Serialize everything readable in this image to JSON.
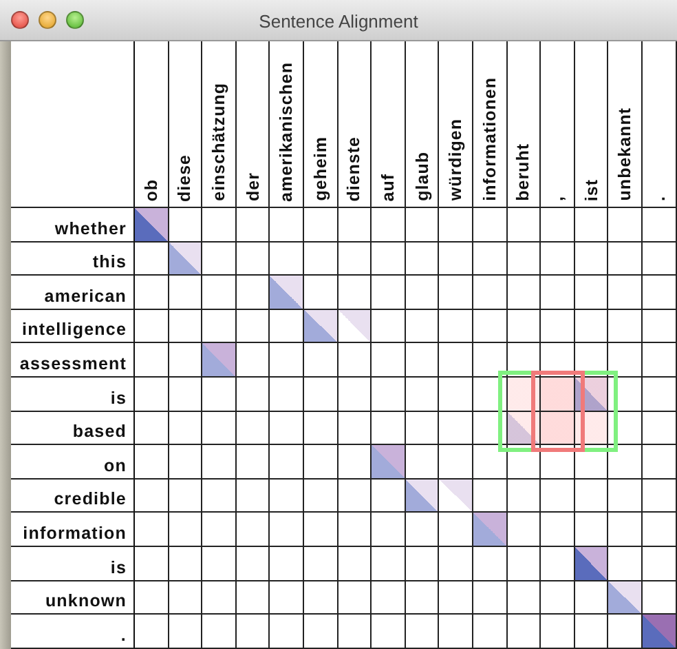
{
  "window": {
    "title": "Sentence Alignment"
  },
  "columns": [
    "ob",
    "diese",
    "einschätzung",
    "der",
    "amerikanischen",
    "geheim",
    "dienste",
    "auf",
    "glaub",
    "würdigen",
    "informationen",
    "beruht",
    ",",
    "ist",
    "unbekannt",
    "."
  ],
  "rows": [
    {
      "word": "whether",
      "cells": [
        {
          "kind": "medium-strong",
          "selected": false,
          "focused": false
        },
        {
          "kind": "empty",
          "selected": false,
          "focused": false
        },
        {
          "kind": "empty",
          "selected": false,
          "focused": false
        },
        {
          "kind": "empty",
          "selected": false,
          "focused": false
        },
        {
          "kind": "empty",
          "selected": false,
          "focused": false
        },
        {
          "kind": "empty",
          "selected": false,
          "focused": false
        },
        {
          "kind": "empty",
          "selected": false,
          "focused": false
        },
        {
          "kind": "empty",
          "selected": false,
          "focused": false
        },
        {
          "kind": "empty",
          "selected": false,
          "focused": false
        },
        {
          "kind": "empty",
          "selected": false,
          "focused": false
        },
        {
          "kind": "empty",
          "selected": false,
          "focused": false
        },
        {
          "kind": "empty",
          "selected": false,
          "focused": false
        },
        {
          "kind": "empty",
          "selected": false,
          "focused": false
        },
        {
          "kind": "empty",
          "selected": false,
          "focused": false
        },
        {
          "kind": "empty",
          "selected": false,
          "focused": false
        },
        {
          "kind": "empty",
          "selected": false,
          "focused": false
        }
      ]
    },
    {
      "word": "this",
      "cells": [
        {
          "kind": "empty",
          "selected": false,
          "focused": false
        },
        {
          "kind": "faint-medium",
          "selected": false,
          "focused": false
        },
        {
          "kind": "empty",
          "selected": false,
          "focused": false
        },
        {
          "kind": "empty",
          "selected": false,
          "focused": false
        },
        {
          "kind": "empty",
          "selected": false,
          "focused": false
        },
        {
          "kind": "empty",
          "selected": false,
          "focused": false
        },
        {
          "kind": "empty",
          "selected": false,
          "focused": false
        },
        {
          "kind": "empty",
          "selected": false,
          "focused": false
        },
        {
          "kind": "empty",
          "selected": false,
          "focused": false
        },
        {
          "kind": "empty",
          "selected": false,
          "focused": false
        },
        {
          "kind": "empty",
          "selected": false,
          "focused": false
        },
        {
          "kind": "empty",
          "selected": false,
          "focused": false
        },
        {
          "kind": "empty",
          "selected": false,
          "focused": false
        },
        {
          "kind": "empty",
          "selected": false,
          "focused": false
        },
        {
          "kind": "empty",
          "selected": false,
          "focused": false
        },
        {
          "kind": "empty",
          "selected": false,
          "focused": false
        }
      ]
    },
    {
      "word": "american",
      "cells": [
        {
          "kind": "empty",
          "selected": false,
          "focused": false
        },
        {
          "kind": "empty",
          "selected": false,
          "focused": false
        },
        {
          "kind": "empty",
          "selected": false,
          "focused": false
        },
        {
          "kind": "empty",
          "selected": false,
          "focused": false
        },
        {
          "kind": "faint-medium",
          "selected": false,
          "focused": false
        },
        {
          "kind": "empty",
          "selected": false,
          "focused": false
        },
        {
          "kind": "empty",
          "selected": false,
          "focused": false
        },
        {
          "kind": "empty",
          "selected": false,
          "focused": false
        },
        {
          "kind": "empty",
          "selected": false,
          "focused": false
        },
        {
          "kind": "empty",
          "selected": false,
          "focused": false
        },
        {
          "kind": "empty",
          "selected": false,
          "focused": false
        },
        {
          "kind": "empty",
          "selected": false,
          "focused": false
        },
        {
          "kind": "empty",
          "selected": false,
          "focused": false
        },
        {
          "kind": "empty",
          "selected": false,
          "focused": false
        },
        {
          "kind": "empty",
          "selected": false,
          "focused": false
        },
        {
          "kind": "empty",
          "selected": false,
          "focused": false
        }
      ]
    },
    {
      "word": "intelligence",
      "cells": [
        {
          "kind": "empty",
          "selected": false,
          "focused": false
        },
        {
          "kind": "empty",
          "selected": false,
          "focused": false
        },
        {
          "kind": "empty",
          "selected": false,
          "focused": false
        },
        {
          "kind": "empty",
          "selected": false,
          "focused": false
        },
        {
          "kind": "empty",
          "selected": false,
          "focused": false
        },
        {
          "kind": "faint-medium",
          "selected": false,
          "focused": false
        },
        {
          "kind": "faint-none",
          "selected": false,
          "focused": false
        },
        {
          "kind": "empty",
          "selected": false,
          "focused": false
        },
        {
          "kind": "empty",
          "selected": false,
          "focused": false
        },
        {
          "kind": "empty",
          "selected": false,
          "focused": false
        },
        {
          "kind": "empty",
          "selected": false,
          "focused": false
        },
        {
          "kind": "empty",
          "selected": false,
          "focused": false
        },
        {
          "kind": "empty",
          "selected": false,
          "focused": false
        },
        {
          "kind": "empty",
          "selected": false,
          "focused": false
        },
        {
          "kind": "empty",
          "selected": false,
          "focused": false
        },
        {
          "kind": "empty",
          "selected": false,
          "focused": false
        }
      ]
    },
    {
      "word": "assessment",
      "cells": [
        {
          "kind": "empty",
          "selected": false,
          "focused": false
        },
        {
          "kind": "empty",
          "selected": false,
          "focused": false
        },
        {
          "kind": "medium-medium",
          "selected": false,
          "focused": false
        },
        {
          "kind": "empty",
          "selected": false,
          "focused": false
        },
        {
          "kind": "empty",
          "selected": false,
          "focused": false
        },
        {
          "kind": "empty",
          "selected": false,
          "focused": false
        },
        {
          "kind": "empty",
          "selected": false,
          "focused": false
        },
        {
          "kind": "empty",
          "selected": false,
          "focused": false
        },
        {
          "kind": "empty",
          "selected": false,
          "focused": false
        },
        {
          "kind": "empty",
          "selected": false,
          "focused": false
        },
        {
          "kind": "empty",
          "selected": false,
          "focused": false
        },
        {
          "kind": "empty",
          "selected": false,
          "focused": false
        },
        {
          "kind": "empty",
          "selected": false,
          "focused": false
        },
        {
          "kind": "empty",
          "selected": false,
          "focused": false
        },
        {
          "kind": "empty",
          "selected": false,
          "focused": false
        },
        {
          "kind": "empty",
          "selected": false,
          "focused": false
        }
      ]
    },
    {
      "word": "is",
      "cells": [
        {
          "kind": "empty",
          "selected": false,
          "focused": false
        },
        {
          "kind": "empty",
          "selected": false,
          "focused": false
        },
        {
          "kind": "empty",
          "selected": false,
          "focused": false
        },
        {
          "kind": "empty",
          "selected": false,
          "focused": false
        },
        {
          "kind": "empty",
          "selected": false,
          "focused": false
        },
        {
          "kind": "empty",
          "selected": false,
          "focused": false
        },
        {
          "kind": "empty",
          "selected": false,
          "focused": false
        },
        {
          "kind": "empty",
          "selected": false,
          "focused": false
        },
        {
          "kind": "empty",
          "selected": false,
          "focused": false
        },
        {
          "kind": "empty",
          "selected": false,
          "focused": false
        },
        {
          "kind": "empty",
          "selected": false,
          "focused": false
        },
        {
          "kind": "empty",
          "selected": true,
          "focused": false
        },
        {
          "kind": "empty",
          "selected": true,
          "focused": true
        },
        {
          "kind": "faint-medium",
          "selected": true,
          "focused": false
        },
        {
          "kind": "empty",
          "selected": false,
          "focused": false
        },
        {
          "kind": "empty",
          "selected": false,
          "focused": false
        }
      ]
    },
    {
      "word": "based",
      "cells": [
        {
          "kind": "empty",
          "selected": false,
          "focused": false
        },
        {
          "kind": "empty",
          "selected": false,
          "focused": false
        },
        {
          "kind": "empty",
          "selected": false,
          "focused": false
        },
        {
          "kind": "empty",
          "selected": false,
          "focused": false
        },
        {
          "kind": "empty",
          "selected": false,
          "focused": false
        },
        {
          "kind": "empty",
          "selected": false,
          "focused": false
        },
        {
          "kind": "empty",
          "selected": false,
          "focused": false
        },
        {
          "kind": "empty",
          "selected": false,
          "focused": false
        },
        {
          "kind": "empty",
          "selected": false,
          "focused": false
        },
        {
          "kind": "empty",
          "selected": false,
          "focused": false
        },
        {
          "kind": "empty",
          "selected": false,
          "focused": false
        },
        {
          "kind": "none-faint",
          "selected": true,
          "focused": false
        },
        {
          "kind": "empty",
          "selected": true,
          "focused": true
        },
        {
          "kind": "empty",
          "selected": true,
          "focused": false
        },
        {
          "kind": "empty",
          "selected": false,
          "focused": false
        },
        {
          "kind": "empty",
          "selected": false,
          "focused": false
        }
      ]
    },
    {
      "word": "on",
      "cells": [
        {
          "kind": "empty",
          "selected": false,
          "focused": false
        },
        {
          "kind": "empty",
          "selected": false,
          "focused": false
        },
        {
          "kind": "empty",
          "selected": false,
          "focused": false
        },
        {
          "kind": "empty",
          "selected": false,
          "focused": false
        },
        {
          "kind": "empty",
          "selected": false,
          "focused": false
        },
        {
          "kind": "empty",
          "selected": false,
          "focused": false
        },
        {
          "kind": "empty",
          "selected": false,
          "focused": false
        },
        {
          "kind": "medium-medium",
          "selected": false,
          "focused": false
        },
        {
          "kind": "empty",
          "selected": false,
          "focused": false
        },
        {
          "kind": "empty",
          "selected": false,
          "focused": false
        },
        {
          "kind": "empty",
          "selected": false,
          "focused": false
        },
        {
          "kind": "empty",
          "selected": false,
          "focused": false
        },
        {
          "kind": "empty",
          "selected": false,
          "focused": false
        },
        {
          "kind": "empty",
          "selected": false,
          "focused": false
        },
        {
          "kind": "empty",
          "selected": false,
          "focused": false
        },
        {
          "kind": "empty",
          "selected": false,
          "focused": false
        }
      ]
    },
    {
      "word": "credible",
      "cells": [
        {
          "kind": "empty",
          "selected": false,
          "focused": false
        },
        {
          "kind": "empty",
          "selected": false,
          "focused": false
        },
        {
          "kind": "empty",
          "selected": false,
          "focused": false
        },
        {
          "kind": "empty",
          "selected": false,
          "focused": false
        },
        {
          "kind": "empty",
          "selected": false,
          "focused": false
        },
        {
          "kind": "empty",
          "selected": false,
          "focused": false
        },
        {
          "kind": "empty",
          "selected": false,
          "focused": false
        },
        {
          "kind": "empty",
          "selected": false,
          "focused": false
        },
        {
          "kind": "faint-medium",
          "selected": false,
          "focused": false
        },
        {
          "kind": "faint-none",
          "selected": false,
          "focused": false
        },
        {
          "kind": "empty",
          "selected": false,
          "focused": false
        },
        {
          "kind": "empty",
          "selected": false,
          "focused": false
        },
        {
          "kind": "empty",
          "selected": false,
          "focused": false
        },
        {
          "kind": "empty",
          "selected": false,
          "focused": false
        },
        {
          "kind": "empty",
          "selected": false,
          "focused": false
        },
        {
          "kind": "empty",
          "selected": false,
          "focused": false
        }
      ]
    },
    {
      "word": "information",
      "cells": [
        {
          "kind": "empty",
          "selected": false,
          "focused": false
        },
        {
          "kind": "empty",
          "selected": false,
          "focused": false
        },
        {
          "kind": "empty",
          "selected": false,
          "focused": false
        },
        {
          "kind": "empty",
          "selected": false,
          "focused": false
        },
        {
          "kind": "empty",
          "selected": false,
          "focused": false
        },
        {
          "kind": "empty",
          "selected": false,
          "focused": false
        },
        {
          "kind": "empty",
          "selected": false,
          "focused": false
        },
        {
          "kind": "empty",
          "selected": false,
          "focused": false
        },
        {
          "kind": "empty",
          "selected": false,
          "focused": false
        },
        {
          "kind": "empty",
          "selected": false,
          "focused": false
        },
        {
          "kind": "medium-medium",
          "selected": false,
          "focused": false
        },
        {
          "kind": "empty",
          "selected": false,
          "focused": false
        },
        {
          "kind": "empty",
          "selected": false,
          "focused": false
        },
        {
          "kind": "empty",
          "selected": false,
          "focused": false
        },
        {
          "kind": "empty",
          "selected": false,
          "focused": false
        },
        {
          "kind": "empty",
          "selected": false,
          "focused": false
        }
      ]
    },
    {
      "word": "is",
      "cells": [
        {
          "kind": "empty",
          "selected": false,
          "focused": false
        },
        {
          "kind": "empty",
          "selected": false,
          "focused": false
        },
        {
          "kind": "empty",
          "selected": false,
          "focused": false
        },
        {
          "kind": "empty",
          "selected": false,
          "focused": false
        },
        {
          "kind": "empty",
          "selected": false,
          "focused": false
        },
        {
          "kind": "empty",
          "selected": false,
          "focused": false
        },
        {
          "kind": "empty",
          "selected": false,
          "focused": false
        },
        {
          "kind": "empty",
          "selected": false,
          "focused": false
        },
        {
          "kind": "empty",
          "selected": false,
          "focused": false
        },
        {
          "kind": "empty",
          "selected": false,
          "focused": false
        },
        {
          "kind": "empty",
          "selected": false,
          "focused": false
        },
        {
          "kind": "empty",
          "selected": false,
          "focused": false
        },
        {
          "kind": "empty",
          "selected": false,
          "focused": false
        },
        {
          "kind": "medium-strong",
          "selected": false,
          "focused": false
        },
        {
          "kind": "empty",
          "selected": false,
          "focused": false
        },
        {
          "kind": "empty",
          "selected": false,
          "focused": false
        }
      ]
    },
    {
      "word": "unknown",
      "cells": [
        {
          "kind": "empty",
          "selected": false,
          "focused": false
        },
        {
          "kind": "empty",
          "selected": false,
          "focused": false
        },
        {
          "kind": "empty",
          "selected": false,
          "focused": false
        },
        {
          "kind": "empty",
          "selected": false,
          "focused": false
        },
        {
          "kind": "empty",
          "selected": false,
          "focused": false
        },
        {
          "kind": "empty",
          "selected": false,
          "focused": false
        },
        {
          "kind": "empty",
          "selected": false,
          "focused": false
        },
        {
          "kind": "empty",
          "selected": false,
          "focused": false
        },
        {
          "kind": "empty",
          "selected": false,
          "focused": false
        },
        {
          "kind": "empty",
          "selected": false,
          "focused": false
        },
        {
          "kind": "empty",
          "selected": false,
          "focused": false
        },
        {
          "kind": "empty",
          "selected": false,
          "focused": false
        },
        {
          "kind": "empty",
          "selected": false,
          "focused": false
        },
        {
          "kind": "empty",
          "selected": false,
          "focused": false
        },
        {
          "kind": "faint-medium",
          "selected": false,
          "focused": false
        },
        {
          "kind": "empty",
          "selected": false,
          "focused": false
        }
      ]
    },
    {
      "word": ".",
      "cells": [
        {
          "kind": "empty",
          "selected": false,
          "focused": false
        },
        {
          "kind": "empty",
          "selected": false,
          "focused": false
        },
        {
          "kind": "empty",
          "selected": false,
          "focused": false
        },
        {
          "kind": "empty",
          "selected": false,
          "focused": false
        },
        {
          "kind": "empty",
          "selected": false,
          "focused": false
        },
        {
          "kind": "empty",
          "selected": false,
          "focused": false
        },
        {
          "kind": "empty",
          "selected": false,
          "focused": false
        },
        {
          "kind": "empty",
          "selected": false,
          "focused": false
        },
        {
          "kind": "empty",
          "selected": false,
          "focused": false
        },
        {
          "kind": "empty",
          "selected": false,
          "focused": false
        },
        {
          "kind": "empty",
          "selected": false,
          "focused": false
        },
        {
          "kind": "empty",
          "selected": false,
          "focused": false
        },
        {
          "kind": "empty",
          "selected": false,
          "focused": false
        },
        {
          "kind": "empty",
          "selected": false,
          "focused": false
        },
        {
          "kind": "empty",
          "selected": false,
          "focused": false
        },
        {
          "kind": "strong-strong",
          "selected": false,
          "focused": false
        }
      ]
    }
  ],
  "highlights": [
    {
      "kind": "selection",
      "color": "#80f080"
    },
    {
      "kind": "focus",
      "color": "#f07a7a"
    }
  ]
}
